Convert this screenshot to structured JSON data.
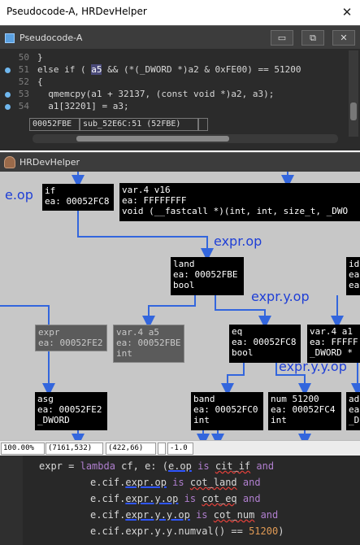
{
  "window": {
    "title": "Pseudocode-A, HRDevHelper",
    "close_glyph": "✕"
  },
  "pseudocode": {
    "tab_title": "Pseudocode-A",
    "buttons": {
      "maximize": "▭",
      "restore": "⧉",
      "close": "✕"
    },
    "lines": [
      {
        "num": "50",
        "text": "}",
        "bp": false
      },
      {
        "num": "51",
        "pre": "else if ( ",
        "hl": "a5",
        "post": " && (*(_DWORD *)a2 & 0xFE00) == 51200",
        "bp": true
      },
      {
        "num": "52",
        "text": "{",
        "bp": false
      },
      {
        "num": "53",
        "text": "  qmemcpy(a1 + 32137, (const void *)a2, a3);",
        "bp": true
      },
      {
        "num": "54",
        "text": "  a1[32201] = a3;",
        "bp": true
      }
    ],
    "status": {
      "address": "00052FBE",
      "location": "sub_52E6C:51 (52FBE)",
      "extra": ""
    }
  },
  "graph": {
    "title": "HRDevHelper",
    "buttons": {
      "maximize": "▭",
      "restore": "⧉",
      "close": "✕"
    },
    "annotations": {
      "e_op": "e.op",
      "expr_op": "expr.op",
      "expr_y_op": "expr.y.op",
      "expr_y_y_op": "expr.y.y.op"
    },
    "nodes": {
      "if": "if\nea: 00052FC8",
      "var_v16": "var.4 v16\nea: FFFFFFFF\nvoid (__fastcall *)(int, int, size_t, _DWO",
      "land": "land\nea: 00052FBE\nbool",
      "id_partial": "id\nea\nea",
      "expr": "expr\nea: 00052FE2",
      "var_a5": "var.4 a5\nea: 00052FBE\nint",
      "eq": "eq\nea: 00052FC8\nbool",
      "var_a1": "var.4 a1\nea: FFFFF\n_DWORD *",
      "asg": "asg\nea: 00052FE2\n_DWORD",
      "band": "band\nea: 00052FC0\nint",
      "num": "num 51200\nea: 00052FC4\nint",
      "ad_partial": "ad\nea\n_D"
    },
    "status": {
      "zoom": "100.00%",
      "pos": "(7161,532)",
      "size": "(422,66)",
      "extra": "",
      "value": "-1.0"
    }
  },
  "python": {
    "lines": [
      [
        {
          "t": "expr",
          "c": ""
        },
        {
          "t": " = ",
          "c": ""
        },
        {
          "t": "lambda",
          "c": "py-kw"
        },
        {
          "t": " cf, e: (",
          "c": ""
        },
        {
          "t": "e.op",
          "c": "py-blue"
        },
        {
          "t": " ",
          "c": ""
        },
        {
          "t": "is",
          "c": "py-kw"
        },
        {
          "t": " ",
          "c": ""
        },
        {
          "t": "cit_if",
          "c": "py-red"
        },
        {
          "t": " ",
          "c": ""
        },
        {
          "t": "and",
          "c": "py-kw"
        }
      ],
      [
        {
          "t": "e.cif.",
          "c": ""
        },
        {
          "t": "expr.op",
          "c": "py-blue"
        },
        {
          "t": " ",
          "c": ""
        },
        {
          "t": "is",
          "c": "py-kw"
        },
        {
          "t": " ",
          "c": ""
        },
        {
          "t": "cot_land",
          "c": "py-red"
        },
        {
          "t": " ",
          "c": ""
        },
        {
          "t": "and",
          "c": "py-kw"
        }
      ],
      [
        {
          "t": "e.cif.",
          "c": ""
        },
        {
          "t": "expr.y.op",
          "c": "py-blue"
        },
        {
          "t": " ",
          "c": ""
        },
        {
          "t": "is",
          "c": "py-kw"
        },
        {
          "t": " ",
          "c": ""
        },
        {
          "t": "cot_eq",
          "c": "py-red"
        },
        {
          "t": " ",
          "c": ""
        },
        {
          "t": "and",
          "c": "py-kw"
        }
      ],
      [
        {
          "t": "e.cif.",
          "c": ""
        },
        {
          "t": "expr.y.y.op",
          "c": "py-blue"
        },
        {
          "t": " ",
          "c": ""
        },
        {
          "t": "is",
          "c": "py-kw"
        },
        {
          "t": " ",
          "c": ""
        },
        {
          "t": "cot_num",
          "c": "py-red"
        },
        {
          "t": " ",
          "c": ""
        },
        {
          "t": "and",
          "c": "py-kw"
        }
      ],
      [
        {
          "t": "e.cif.expr.y.y.numval() ",
          "c": ""
        },
        {
          "t": "==",
          "c": ""
        },
        {
          "t": " ",
          "c": ""
        },
        {
          "t": "51200",
          "c": "py-num"
        },
        {
          "t": ")",
          "c": ""
        }
      ]
    ]
  },
  "colors": {
    "graph_bg": "#c7c7c7",
    "edge": "#3366dd",
    "annotation": "#1f3fd6",
    "node_bg": "#000000",
    "dim_node_bg": "#5b5b5b",
    "breakpoint": "#6fb7ee"
  }
}
